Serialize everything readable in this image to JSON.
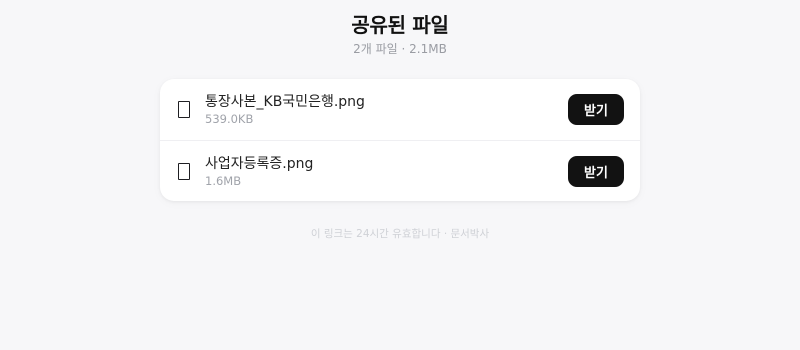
{
  "header": {
    "title": "공유된 파일",
    "subtitle": "2개 파일 · 2.1MB"
  },
  "files": [
    {
      "name": "통장사본_KB국민은행.png",
      "size": "539.0KB",
      "icon": "file-icon",
      "action_label": "받기"
    },
    {
      "name": "사업자등록증.png",
      "size": "1.6MB",
      "icon": "file-icon",
      "action_label": "받기"
    }
  ],
  "footer": {
    "note": "이 링크는 24시간 유효합니다 · 문서박사"
  },
  "colors": {
    "background": "#f7f7f9",
    "card": "#ffffff",
    "button": "#121212",
    "button_text": "#ffffff",
    "muted_text": "#9a9ca3"
  }
}
